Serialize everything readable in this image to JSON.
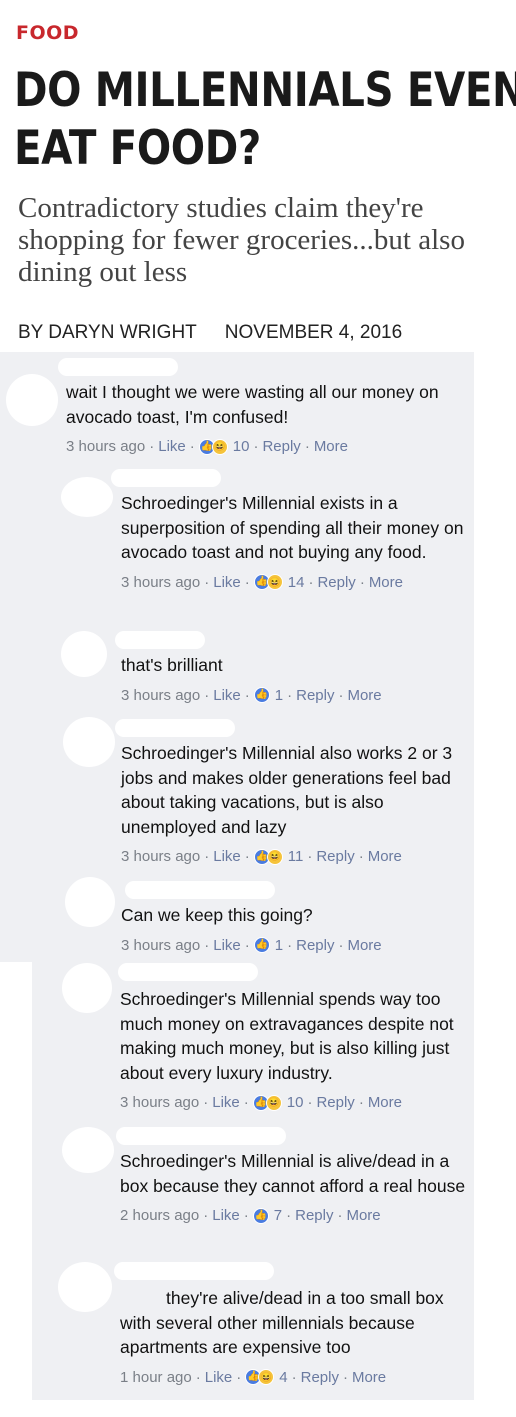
{
  "article": {
    "category": "FOOD",
    "headline_lines": [
      "DO MILLENNIALS EVEN",
      "EAT FOOD?"
    ],
    "subhead": "Contradictory studies claim they're shopping for fewer groceries...but also dining out less",
    "byline": "BY DARYN WRIGHT",
    "date": "NOVEMBER 4, 2016"
  },
  "meta_labels": {
    "like": "Like",
    "reply": "Reply",
    "more": "More",
    "sep": "·"
  },
  "comments": [
    {
      "text": "wait I thought we were wasting all our money on avocado toast, I'm confused!",
      "time": "3 hours ago",
      "reactions": [
        "like",
        "haha"
      ],
      "count": "10"
    },
    {
      "text": "Schroedinger's Millennial exists in a superposition of spending all their money on avocado toast and not buying any food.",
      "time": "3 hours ago",
      "reactions": [
        "like",
        "haha"
      ],
      "count": "14"
    },
    {
      "text": "that's brilliant",
      "time": "3 hours ago",
      "reactions": [
        "like"
      ],
      "count": "1"
    },
    {
      "text": "Schroedinger's Millennial also works 2 or 3 jobs and makes older generations feel bad about taking vacations, but is also unemployed and lazy",
      "time": "3 hours ago",
      "reactions": [
        "like",
        "haha"
      ],
      "count": "11"
    },
    {
      "text": "Can we keep this going?",
      "time": "3 hours ago",
      "reactions": [
        "like"
      ],
      "count": "1"
    },
    {
      "text": "Schroedinger's Millennial spends way too much money on extravagances despite not making much money, but is also killing just about every luxury industry.",
      "time": "3 hours ago",
      "reactions": [
        "like",
        "haha"
      ],
      "count": "10"
    },
    {
      "text": "Schroedinger's Millennial is alive/dead in a box because they cannot afford a real house",
      "time": "2 hours ago",
      "reactions": [
        "like"
      ],
      "count": "7"
    },
    {
      "text": "they're alive/dead in a too small box with several other millennials because apartments are expensive too",
      "time": "1 hour ago",
      "reactions": [
        "like",
        "haha"
      ],
      "count": "4"
    }
  ],
  "colors": {
    "category": "#c8282d",
    "comment_bg": "#eff0f3",
    "link": "#6a7aa0",
    "like": "#4a7ce0",
    "haha": "#f5c33b"
  }
}
